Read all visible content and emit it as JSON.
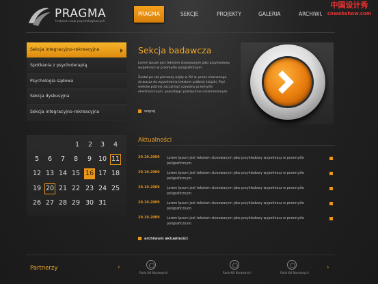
{
  "header": {
    "logo_title": "PRAGMA",
    "logo_subtitle": "Instytut nauk psychologicznych",
    "nav": [
      "PRAGMA",
      "SEKCJE",
      "PROJEKTY",
      "GALERIA",
      "ARCHIWUM"
    ],
    "nav_active_index": 0
  },
  "watermark": {
    "line1": "中国设计秀",
    "line2": "cnwebshow.com"
  },
  "sidebar": {
    "items": [
      {
        "label": "Sekcja integracyjno-rekreacyjna",
        "active": true
      },
      {
        "label": "Spotkania z psychoterapią",
        "active": false
      },
      {
        "label": "Psychologia sądowa",
        "active": false
      },
      {
        "label": "Sekcja dyskusyjna",
        "active": false
      },
      {
        "label": "Sekcja integracyjno-rekreacyjna",
        "active": false
      }
    ]
  },
  "feature": {
    "title": "Sekcja badawcza",
    "paragraph1": "Lorem Ipsum jest tekstem stosowanym jako przykładowy wypełniacz w przemyśle poligraficznym.",
    "paragraph2": "Został po raz pierwszy użyty w XV w. przez nieznanego drukarza do wypełnienia tekstem próbnej książki. Pięć wieków później zaczął być używany przemyśle elektronicznym, pozostając praktycznie niezmienionym.",
    "more_label": "więcej"
  },
  "calendar": {
    "boxed_day": 11,
    "filled_day": 16,
    "boxed_day_2": 20,
    "rows": [
      [
        "",
        "",
        "",
        "1",
        "2",
        "3",
        "4"
      ],
      [
        "5",
        "6",
        "7",
        "8",
        "9",
        "10",
        "11"
      ],
      [
        "12",
        "13",
        "14",
        "15",
        "16",
        "17",
        "18"
      ],
      [
        "19",
        "20",
        "21",
        "22",
        "23",
        "24",
        "25"
      ],
      [
        "26",
        "27",
        "28",
        "29",
        "30",
        "31",
        ""
      ]
    ]
  },
  "news": {
    "title": "Aktualności",
    "items": [
      {
        "date": "20.10.2009",
        "text": "Lorem Ipsum jest tekstem stosowanym jako przykładowy wypełniacz w przemyśle poligraficznym."
      },
      {
        "date": "20.10.2009",
        "text": "Lorem Ipsum jest tekstem stosowanym jako przykładowy wypełniacz w przemyśle poligraficznym."
      },
      {
        "date": "20.10.2009",
        "text": "Lorem Ipsum jest tekstem stosowanym jako przykładowy wypełniacz w przemyśle poligraficznym."
      },
      {
        "date": "20.10.2009",
        "text": "Lorem Ipsum jest tekstem stosowanym jako przykładowy wypełniacz w przemyśle poligraficznym."
      },
      {
        "date": "20.10.2009",
        "text": "Lorem Ipsum jest tekstem stosowanym jako przykładowy wypełniacz w przemyśle poligraficznym."
      }
    ],
    "archive_label": "archiwum aktualności"
  },
  "partners": {
    "title": "Partnerzy",
    "prev_icon": "chevron-left-icon",
    "next_icon": "chevron-right-icon",
    "items": [
      {
        "name": "Rada Kół Naukowych"
      },
      {
        "name": "Rada Kół Naukowych"
      },
      {
        "name": "Rada Kół Naukowych"
      }
    ]
  },
  "colors": {
    "accent": "#e9961a",
    "background": "#1c1c1c"
  }
}
